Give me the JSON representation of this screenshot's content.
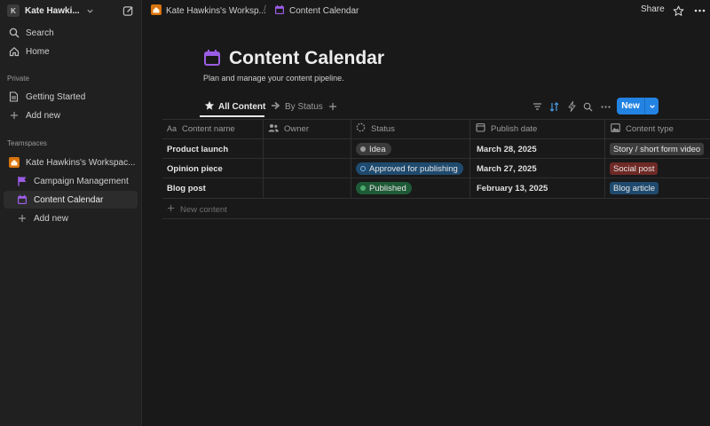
{
  "colors": {
    "accent": "#2383e2",
    "page_icon": "#9b5de5",
    "workspace_icon": "#d9730d",
    "status_idea_bg": "#3b3b3b",
    "status_approved_bg": "#1f4a6e",
    "status_published_bg": "#1f5a37",
    "type_story_bg": "#3d3d3d",
    "type_social_bg": "#6e2a26",
    "type_blog_bg": "#1f4a6e"
  },
  "sidebar": {
    "workspace_badge": "K",
    "workspace_name": "Kate Hawki...",
    "top_items": [
      {
        "label": "Search",
        "icon": "search-icon"
      },
      {
        "label": "Home",
        "icon": "home-icon"
      }
    ],
    "private_section": "Private",
    "private_items": [
      {
        "label": "Getting Started",
        "icon": "page-icon"
      },
      {
        "label": "Add new",
        "icon": "plus-icon"
      }
    ],
    "teamspaces_section": "Teamspaces",
    "teamspace_items": [
      {
        "label": "Kate Hawkins's Workspac...",
        "icon": "house-icon"
      },
      {
        "label": "Campaign Management",
        "icon": "flag-icon"
      },
      {
        "label": "Content Calendar",
        "icon": "calendar-icon"
      },
      {
        "label": "Add new",
        "icon": "plus-icon"
      }
    ]
  },
  "topbar": {
    "breadcrumb_workspace": "Kate Hawkins's Worksp...",
    "breadcrumb_separator": "/",
    "breadcrumb_page": "Content Calendar",
    "share_label": "Share"
  },
  "page": {
    "title": "Content Calendar",
    "description": "Plan and manage your content pipeline."
  },
  "views": {
    "tabs": [
      {
        "label": "All Content",
        "icon": "star-icon",
        "active": true
      },
      {
        "label": "By Status",
        "icon": "arrow-right-icon",
        "active": false
      }
    ],
    "new_button_label": "New"
  },
  "table": {
    "columns": [
      {
        "label": "Content name",
        "icon": "Aa"
      },
      {
        "label": "Owner",
        "icon": "people-icon"
      },
      {
        "label": "Status",
        "icon": "status-icon"
      },
      {
        "label": "Publish date",
        "icon": "calendar-icon"
      },
      {
        "label": "Content type",
        "icon": "image-icon"
      }
    ],
    "rows": [
      {
        "name": "Product launch",
        "owner": "",
        "status": "Idea",
        "date": "March 28, 2025",
        "type": "Story / short form video"
      },
      {
        "name": "Opinion piece",
        "owner": "",
        "status": "Approved for publishing",
        "date": "March 27, 2025",
        "type": "Social post"
      },
      {
        "name": "Blog post",
        "owner": "",
        "status": "Published",
        "date": "February 13, 2025",
        "type": "Blog article"
      }
    ],
    "new_row_label": "New content"
  }
}
